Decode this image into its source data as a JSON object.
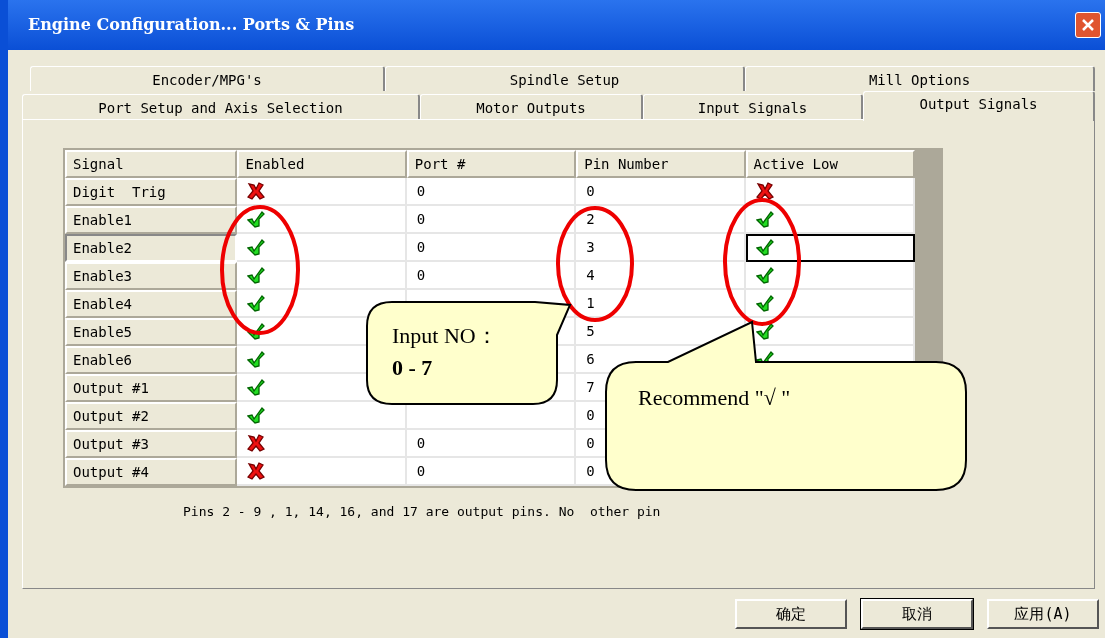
{
  "window": {
    "title": "Engine Configuration... Ports & Pins"
  },
  "tab_rows": [
    [
      {
        "label": "Encoder/MPG's",
        "selected": false
      },
      {
        "label": "Spindle Setup",
        "selected": false
      },
      {
        "label": "Mill Options",
        "selected": false
      }
    ],
    [
      {
        "label": "Port Setup and Axis Selection",
        "selected": false
      },
      {
        "label": "Motor Outputs",
        "selected": false
      },
      {
        "label": "Input Signals",
        "selected": false
      },
      {
        "label": "Output Signals",
        "selected": true
      }
    ]
  ],
  "table": {
    "columns": [
      "Signal",
      "Enabled",
      "Port #",
      "Pin Number",
      "Active Low"
    ],
    "rows": [
      {
        "signal": "Digit  Trig",
        "enabled": false,
        "port": "0",
        "pin": "0",
        "active_low": false,
        "selected": false
      },
      {
        "signal": "Enable1",
        "enabled": true,
        "port": "0",
        "pin": "2",
        "active_low": true,
        "selected": false
      },
      {
        "signal": "Enable2",
        "enabled": true,
        "port": "0",
        "pin": "3",
        "active_low": true,
        "selected": true
      },
      {
        "signal": "Enable3",
        "enabled": true,
        "port": "0",
        "pin": "4",
        "active_low": true,
        "selected": false
      },
      {
        "signal": "Enable4",
        "enabled": true,
        "pin": "1",
        "active_low": true,
        "selected": false
      },
      {
        "signal": "Enable5",
        "enabled": true,
        "pin": "5",
        "active_low": true,
        "selected": false
      },
      {
        "signal": "Enable6",
        "enabled": true,
        "pin": "6",
        "active_low": true,
        "selected": false
      },
      {
        "signal": "Output #1",
        "enabled": true,
        "pin": "7",
        "selected": false
      },
      {
        "signal": "Output #2",
        "enabled": true,
        "pin": "0",
        "selected": false
      },
      {
        "signal": "Output #3",
        "enabled": false,
        "port": "0",
        "pin": "0",
        "selected": false
      },
      {
        "signal": "Output #4",
        "enabled": false,
        "port": "0",
        "pin": "0",
        "selected": false
      }
    ]
  },
  "note": "Pins 2 - 9 , 1, 14, 16, and 17 are output pins. No  other pin",
  "buttons": [
    "确定",
    "取消",
    "应用(A)"
  ],
  "callouts": [
    {
      "lines": [
        "Input NO：",
        "**0 - 7**"
      ]
    },
    {
      "lines": [
        "Recommend \"√ \""
      ]
    }
  ]
}
